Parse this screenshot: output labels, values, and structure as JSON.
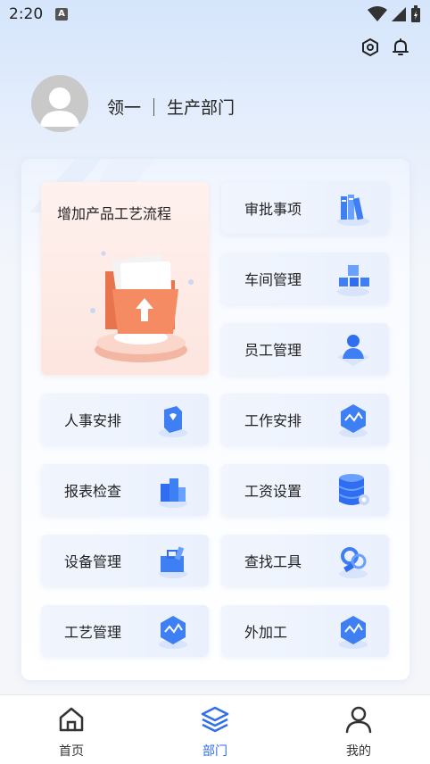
{
  "status_bar": {
    "time": "2:20",
    "notification_letter": "A"
  },
  "header": {
    "settings_icon": "hexagon-gear-icon",
    "bell_icon": "bell-icon"
  },
  "profile": {
    "name": "领一",
    "department": "生产部门"
  },
  "featured": {
    "label": "增加产品工艺流程"
  },
  "tiles": [
    {
      "label": "审批事项",
      "icon": "books-icon"
    },
    {
      "label": "车间管理",
      "icon": "cubes-icon"
    },
    {
      "label": "员工管理",
      "icon": "person-icon"
    },
    {
      "label": "人事安排",
      "icon": "document-cube-icon"
    },
    {
      "label": "工作安排",
      "icon": "hexagon-chart-icon"
    },
    {
      "label": "报表检查",
      "icon": "bar-blocks-icon"
    },
    {
      "label": "工资设置",
      "icon": "database-gear-icon"
    },
    {
      "label": "设备管理",
      "icon": "toolbox-icon"
    },
    {
      "label": "查找工具",
      "icon": "search-tool-icon"
    },
    {
      "label": "工艺管理",
      "icon": "hexagon-chart-icon"
    },
    {
      "label": "外加工",
      "icon": "hexagon-chart-icon"
    }
  ],
  "bottom_nav": [
    {
      "label": "首页",
      "icon": "home-icon",
      "active": false
    },
    {
      "label": "部门",
      "icon": "layers-icon",
      "active": true
    },
    {
      "label": "我的",
      "icon": "user-icon",
      "active": false
    }
  ],
  "colors": {
    "accent": "#2f6ef0",
    "icon_blue": "#3f7ff4"
  }
}
